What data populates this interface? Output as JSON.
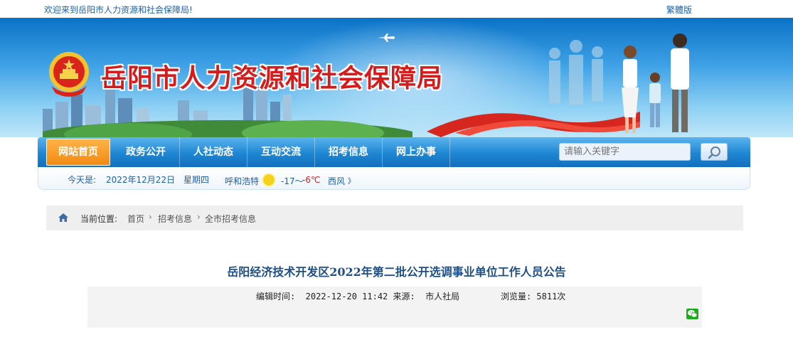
{
  "topbar": {
    "welcome": "欢迎来到岳阳市人力资源和社会保障局!",
    "traditional_link": "繁體版"
  },
  "banner": {
    "title": "岳阳市人力资源和社会保障局"
  },
  "nav": {
    "items": [
      "网站首页",
      "政务公开",
      "人社动态",
      "互动交流",
      "招考信息",
      "网上办事"
    ],
    "active_index": 0,
    "search_placeholder": "请输入关键字"
  },
  "infobar": {
    "today_label": "今天是:",
    "date": "2022年12月22日",
    "weekday": "星期四",
    "city": "呼和浩特",
    "temp_low": "-17～",
    "temp_high": "-6℃",
    "wind": "西风",
    "more": "》"
  },
  "breadcrumb": {
    "label": "当前位置:",
    "items": [
      "首页",
      "招考信息",
      "全市招考信息"
    ],
    "separator": "›"
  },
  "article": {
    "title": "岳阳经济技术开发区2022年第二批公开选调事业单位工作人员公告",
    "meta_line": "编辑时间:  2022-12-20 11:42 来源:  市人社局        浏览量: 5811次"
  },
  "colors": {
    "nav_blue": "#1e86d3",
    "nav_active": "#f08a12",
    "title_red": "#d41c1c",
    "link_blue": "#1f5fa8"
  }
}
